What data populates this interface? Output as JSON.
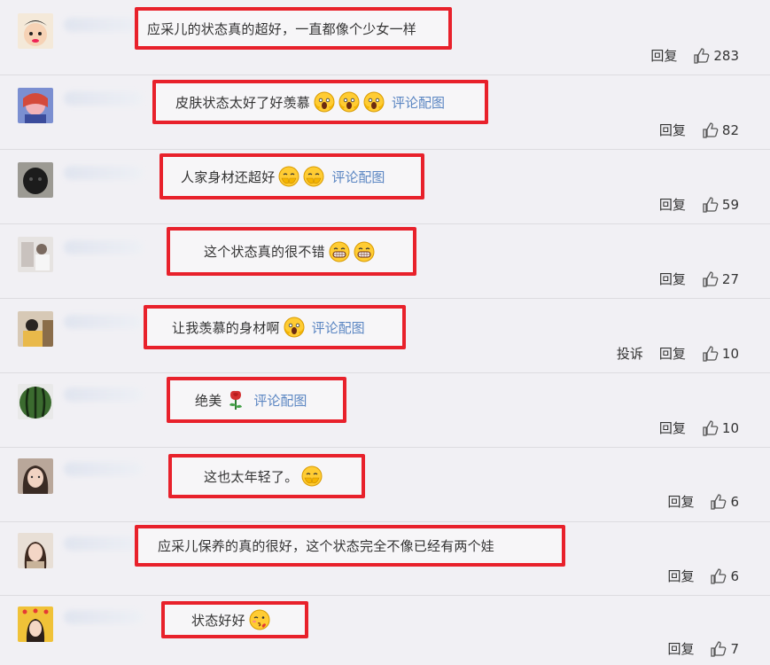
{
  "comments": [
    {
      "text": "应采儿的状态真的超好，一直都像个少女一样",
      "emojis": [],
      "pic_link": "",
      "actions": [
        "回复"
      ],
      "likes": "283"
    },
    {
      "text": "皮肤状态太好了好羡慕",
      "emojis": [
        "scream-face-icon",
        "scream-face-icon",
        "scream-face-icon"
      ],
      "pic_link": "评论配图",
      "actions": [
        "回复"
      ],
      "likes": "82"
    },
    {
      "text": "人家身材还超好",
      "emojis": [
        "giggle-face-icon",
        "giggle-face-icon"
      ],
      "pic_link": "评论配图",
      "actions": [
        "回复"
      ],
      "likes": "59"
    },
    {
      "text": "这个状态真的很不错",
      "emojis": [
        "grin-face-icon",
        "grin-face-icon"
      ],
      "pic_link": "",
      "actions": [
        "回复"
      ],
      "likes": "27"
    },
    {
      "text": "让我羡慕的身材啊",
      "emojis": [
        "scream-face-icon"
      ],
      "pic_link": "评论配图",
      "actions": [
        "投诉",
        "回复"
      ],
      "likes": "10"
    },
    {
      "text": "绝美",
      "emojis": [
        "rose-icon"
      ],
      "pic_link": "评论配图",
      "actions": [
        "回复"
      ],
      "likes": "10"
    },
    {
      "text": "这也太年轻了。",
      "emojis": [
        "giggle-face-icon"
      ],
      "pic_link": "",
      "actions": [
        "回复"
      ],
      "likes": "6"
    },
    {
      "text": "应采儿保养的真的很好，这个状态完全不像已经有两个娃",
      "emojis": [],
      "pic_link": "",
      "actions": [
        "回复"
      ],
      "likes": "6"
    },
    {
      "text": "状态好好",
      "emojis": [
        "kiss-face-icon"
      ],
      "pic_link": "",
      "actions": [
        "回复"
      ],
      "likes": "7"
    }
  ],
  "colors": {
    "highlight_border": "#e8212b",
    "link": "#5b86c2",
    "background": "#f1f0f4"
  }
}
